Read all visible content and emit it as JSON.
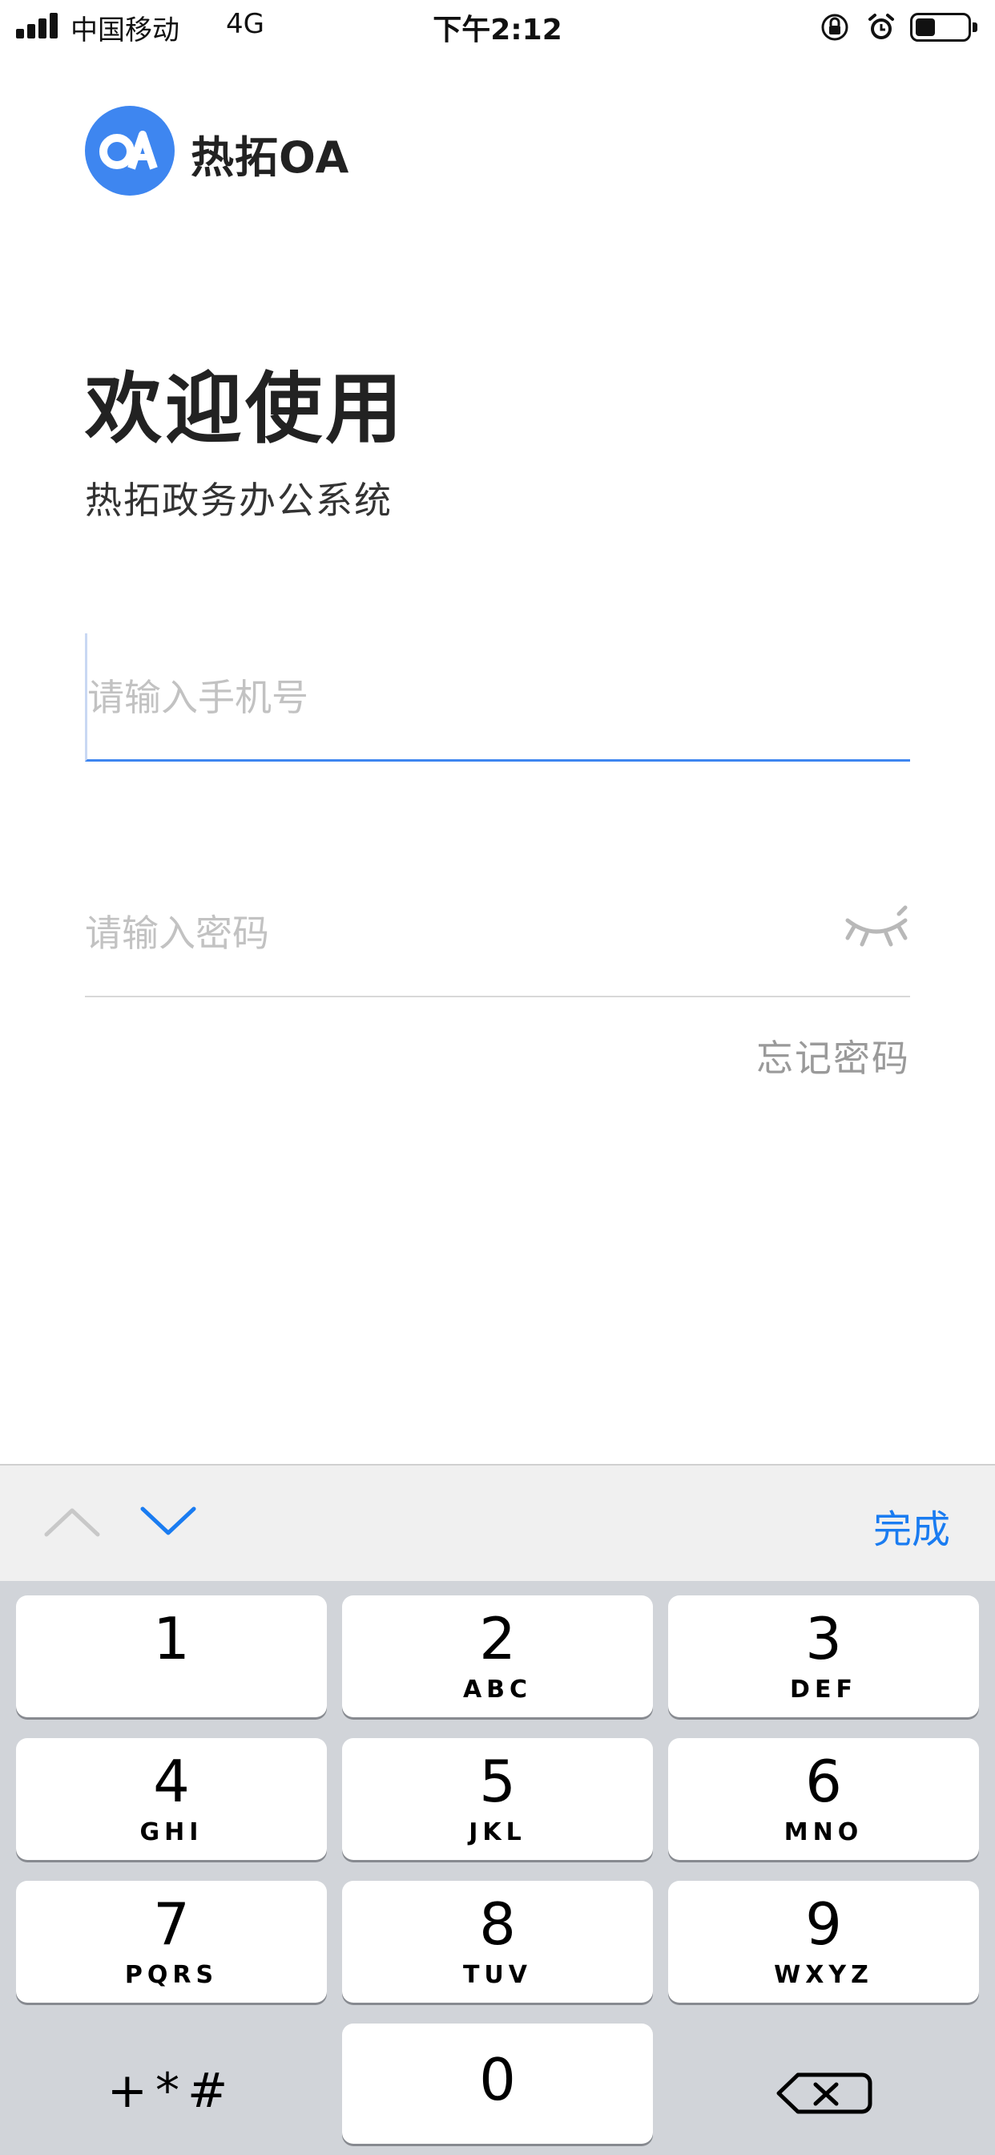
{
  "status_bar": {
    "carrier": "中国移动",
    "network": "4G",
    "time": "下午2:12"
  },
  "app": {
    "logo_mark": "OA",
    "logo_text": "热拓OA",
    "brand_color": "#3E86F0"
  },
  "welcome": {
    "title": "欢迎使用",
    "subtitle": "热拓政务办公系统"
  },
  "form": {
    "phone_placeholder": "请输入手机号",
    "phone_value": "",
    "password_placeholder": "请输入密码",
    "password_value": "",
    "forgot_label": "忘记密码"
  },
  "keyboard": {
    "done_label": "完成",
    "accent_color": "#1a7cf1",
    "keys": [
      {
        "num": "1",
        "letters": ""
      },
      {
        "num": "2",
        "letters": "ABC"
      },
      {
        "num": "3",
        "letters": "DEF"
      },
      {
        "num": "4",
        "letters": "GHI"
      },
      {
        "num": "5",
        "letters": "JKL"
      },
      {
        "num": "6",
        "letters": "MNO"
      },
      {
        "num": "7",
        "letters": "PQRS"
      },
      {
        "num": "8",
        "letters": "TUV"
      },
      {
        "num": "9",
        "letters": "WXYZ"
      },
      {
        "num": "0",
        "letters": ""
      }
    ],
    "symbols_label": "+*#"
  }
}
